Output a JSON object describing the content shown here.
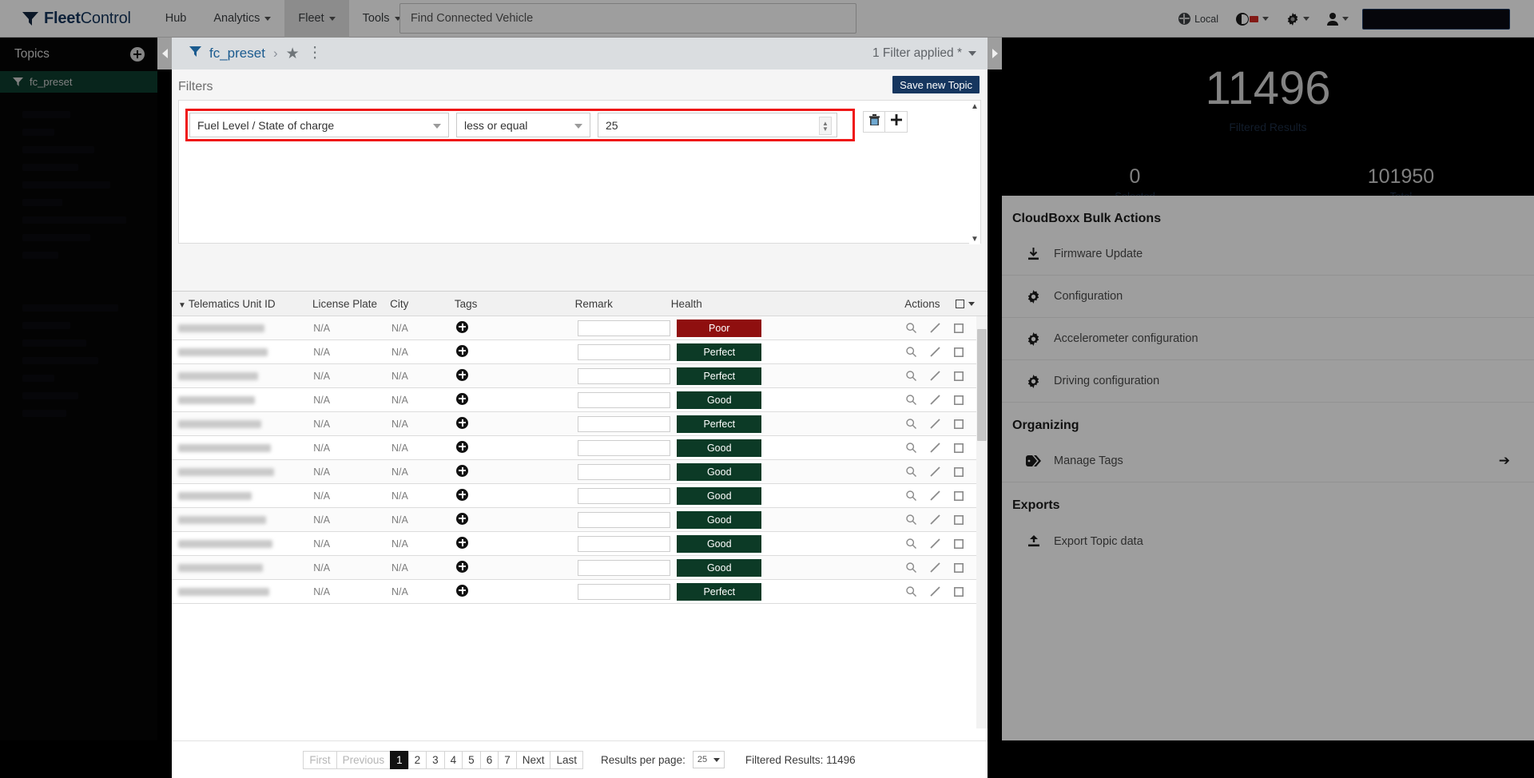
{
  "header": {
    "brand_bold": "Fleet",
    "brand_light": "Control",
    "nav": [
      {
        "label": "Hub",
        "has_caret": false,
        "active": false
      },
      {
        "label": "Analytics",
        "has_caret": true,
        "active": false
      },
      {
        "label": "Fleet",
        "has_caret": true,
        "active": true
      },
      {
        "label": "Tools",
        "has_caret": true,
        "active": false
      }
    ],
    "search_placeholder": "Find Connected Vehicle",
    "search_value": "",
    "locale_label": "Local",
    "icons": [
      "globe-icon",
      "flag-icon",
      "gear-icon",
      "user-icon"
    ]
  },
  "sidebar": {
    "title": "Topics",
    "add_icon": "plus-circle-icon",
    "items": [
      {
        "label": "fc_preset",
        "icon": "funnel-icon",
        "selected": true
      }
    ]
  },
  "breadcrumb": {
    "icon": "funnel-icon",
    "name": "fc_preset",
    "separator": "›",
    "star_icon": "star-icon",
    "kebab_icon": "more-vertical-icon",
    "filter_applied": "1 Filter applied *"
  },
  "filters_panel": {
    "title": "Filters",
    "save_label": "Save new Topic",
    "row": {
      "field_value": "Fuel Level / State of charge",
      "operator_value": "less or equal",
      "number_value": "25",
      "delete_icon": "trash-icon",
      "add_icon": "plus-icon"
    },
    "highlight_color": "#ef1616"
  },
  "table": {
    "columns": [
      "Telematics Unit ID",
      "License Plate",
      "City",
      "Tags",
      "Remark",
      "Health",
      "Actions"
    ],
    "sort_column": "Telematics Unit ID",
    "action_icons": [
      "search-icon",
      "pencil-icon",
      "checkbox-icon"
    ],
    "tag_icon": "plus-circle-icon",
    "rows": [
      {
        "unit_id": "",
        "redact_w": 108,
        "license_plate": "N/A",
        "city": "N/A",
        "remark": "",
        "health": "Poor",
        "health_color": "#8f0f0f"
      },
      {
        "unit_id": "",
        "redact_w": 112,
        "license_plate": "N/A",
        "city": "N/A",
        "remark": "",
        "health": "Perfect",
        "health_color": "#0c3a26"
      },
      {
        "unit_id": "",
        "redact_w": 100,
        "license_plate": "N/A",
        "city": "N/A",
        "remark": "",
        "health": "Perfect",
        "health_color": "#0c3a26"
      },
      {
        "unit_id": "",
        "redact_w": 96,
        "license_plate": "N/A",
        "city": "N/A",
        "remark": "",
        "health": "Good",
        "health_color": "#0c3a26"
      },
      {
        "unit_id": "",
        "redact_w": 104,
        "license_plate": "N/A",
        "city": "N/A",
        "remark": "",
        "health": "Perfect",
        "health_color": "#0c3a26"
      },
      {
        "unit_id": "",
        "redact_w": 116,
        "license_plate": "N/A",
        "city": "N/A",
        "remark": "",
        "health": "Good",
        "health_color": "#0c3a26"
      },
      {
        "unit_id": "",
        "redact_w": 120,
        "license_plate": "N/A",
        "city": "N/A",
        "remark": "",
        "health": "Good",
        "health_color": "#0c3a26"
      },
      {
        "unit_id": "",
        "redact_w": 92,
        "license_plate": "N/A",
        "city": "N/A",
        "remark": "",
        "health": "Good",
        "health_color": "#0c3a26"
      },
      {
        "unit_id": "",
        "redact_w": 110,
        "license_plate": "N/A",
        "city": "N/A",
        "remark": "",
        "health": "Good",
        "health_color": "#0c3a26"
      },
      {
        "unit_id": "",
        "redact_w": 118,
        "license_plate": "N/A",
        "city": "N/A",
        "remark": "",
        "health": "Good",
        "health_color": "#0c3a26"
      },
      {
        "unit_id": "",
        "redact_w": 106,
        "license_plate": "N/A",
        "city": "N/A",
        "remark": "",
        "health": "Good",
        "health_color": "#0c3a26"
      },
      {
        "unit_id": "",
        "redact_w": 114,
        "license_plate": "N/A",
        "city": "N/A",
        "remark": "",
        "health": "Perfect",
        "health_color": "#0c3a26"
      }
    ]
  },
  "pagination": {
    "first": "First",
    "previous": "Previous",
    "pages": [
      "1",
      "2",
      "3",
      "4",
      "5",
      "6",
      "7"
    ],
    "current_page": "1",
    "next": "Next",
    "last": "Last",
    "results_per_page_label": "Results per page:",
    "results_per_page_value": "25",
    "filtered_results": "Filtered Results: 11496"
  },
  "stats": {
    "filtered_value": "11496",
    "filtered_label": "Filtered Results",
    "selected_value": "0",
    "selected_label": "Selected",
    "total_value": "101950",
    "total_label": "Total"
  },
  "right_panel": {
    "sections": [
      {
        "title": "CloudBoxx Bulk Actions",
        "items": [
          {
            "label": "Firmware Update",
            "icon": "download-icon",
            "arrow": ""
          },
          {
            "label": "Configuration",
            "icon": "gear-icon",
            "arrow": ""
          },
          {
            "label": "Accelerometer configuration",
            "icon": "gear-icon",
            "arrow": ""
          },
          {
            "label": "Driving configuration",
            "icon": "gear-icon",
            "arrow": ""
          }
        ]
      },
      {
        "title": "Organizing",
        "items": [
          {
            "label": "Manage Tags",
            "icon": "tag-icon",
            "arrow": "➔"
          }
        ]
      },
      {
        "title": "Exports",
        "items": [
          {
            "label": "Export Topic data",
            "icon": "export-icon",
            "arrow": ""
          }
        ]
      }
    ]
  }
}
